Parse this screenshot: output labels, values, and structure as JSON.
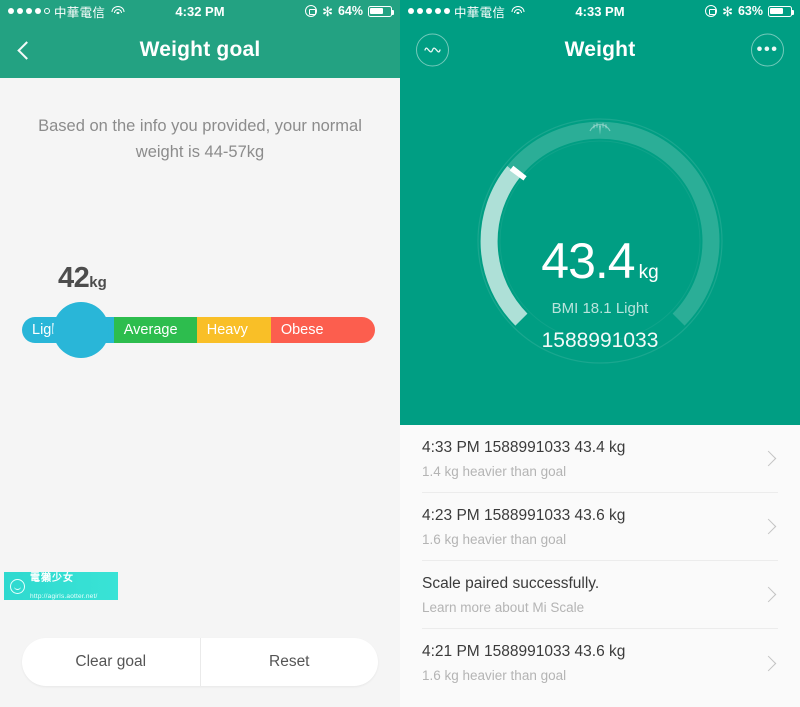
{
  "left": {
    "statusbar": {
      "signal_dots": [
        true,
        true,
        true,
        true,
        false
      ],
      "carrier": "中華電信",
      "wifi": "wifi-icon",
      "time": "4:32 PM",
      "lock": "rotation-lock-icon",
      "bluetooth": "✻",
      "battery_pct": "64%",
      "battery_level": 64
    },
    "nav": {
      "back": "back-chevron-icon",
      "title": "Weight goal"
    },
    "info": "Based on the info you provided, your normal weight is 44-57kg",
    "goal": {
      "value_number": "42",
      "value_unit": "kg",
      "thumb_percent": 16.7,
      "segments": [
        {
          "label": "Light",
          "color": "#29b6d8",
          "width_pct": 26.0
        },
        {
          "label": "Average",
          "color": "#2dbd4e",
          "width_pct": 23.5
        },
        {
          "label": "Heavy",
          "color": "#f9bf27",
          "width_pct": 21.0
        },
        {
          "label": "Obese",
          "color": "#fc5e4e",
          "width_pct": 29.5
        }
      ]
    },
    "watermark": {
      "name": "電獺少女",
      "url": "http://agirls.aotter.net/"
    },
    "buttons": {
      "clear": "Clear goal",
      "reset": "Reset"
    }
  },
  "right": {
    "statusbar": {
      "signal_dots": [
        true,
        true,
        true,
        true,
        true
      ],
      "carrier": "中華電信",
      "wifi": "wifi-icon",
      "time": "4:33 PM",
      "lock": "rotation-lock-icon",
      "bluetooth": "✻",
      "battery_pct": "63%",
      "battery_level": 63
    },
    "nav": {
      "left_icon": "pulse-wave-icon",
      "title": "Weight",
      "right_icon": "ellipsis-icon"
    },
    "hero": {
      "scale_icon": "scale-icon",
      "weight": "43.4",
      "weight_unit": "kg",
      "bmi": "BMI 18.1 Light",
      "device_id": "1588991033",
      "arc_progress_pct": 34
    },
    "pager": {
      "count": 3,
      "active_index": 2
    },
    "list": [
      {
        "title": "4:33 PM 1588991033 43.4 kg",
        "sub": "1.4 kg heavier than goal"
      },
      {
        "title": "4:23 PM 1588991033 43.6 kg",
        "sub": "1.6 kg heavier than goal"
      },
      {
        "title": "Scale paired successfully.",
        "sub": "Learn more about Mi Scale"
      },
      {
        "title": "4:21 PM 1588991033 43.6 kg",
        "sub": "1.6 kg heavier than goal"
      }
    ]
  },
  "colors": {
    "left_header": "#23a282",
    "right_header": "#009e83",
    "accent_cyan": "#29b6d8",
    "green": "#2dbd4e",
    "yellow": "#f9bf27",
    "red": "#fc5e4e"
  }
}
